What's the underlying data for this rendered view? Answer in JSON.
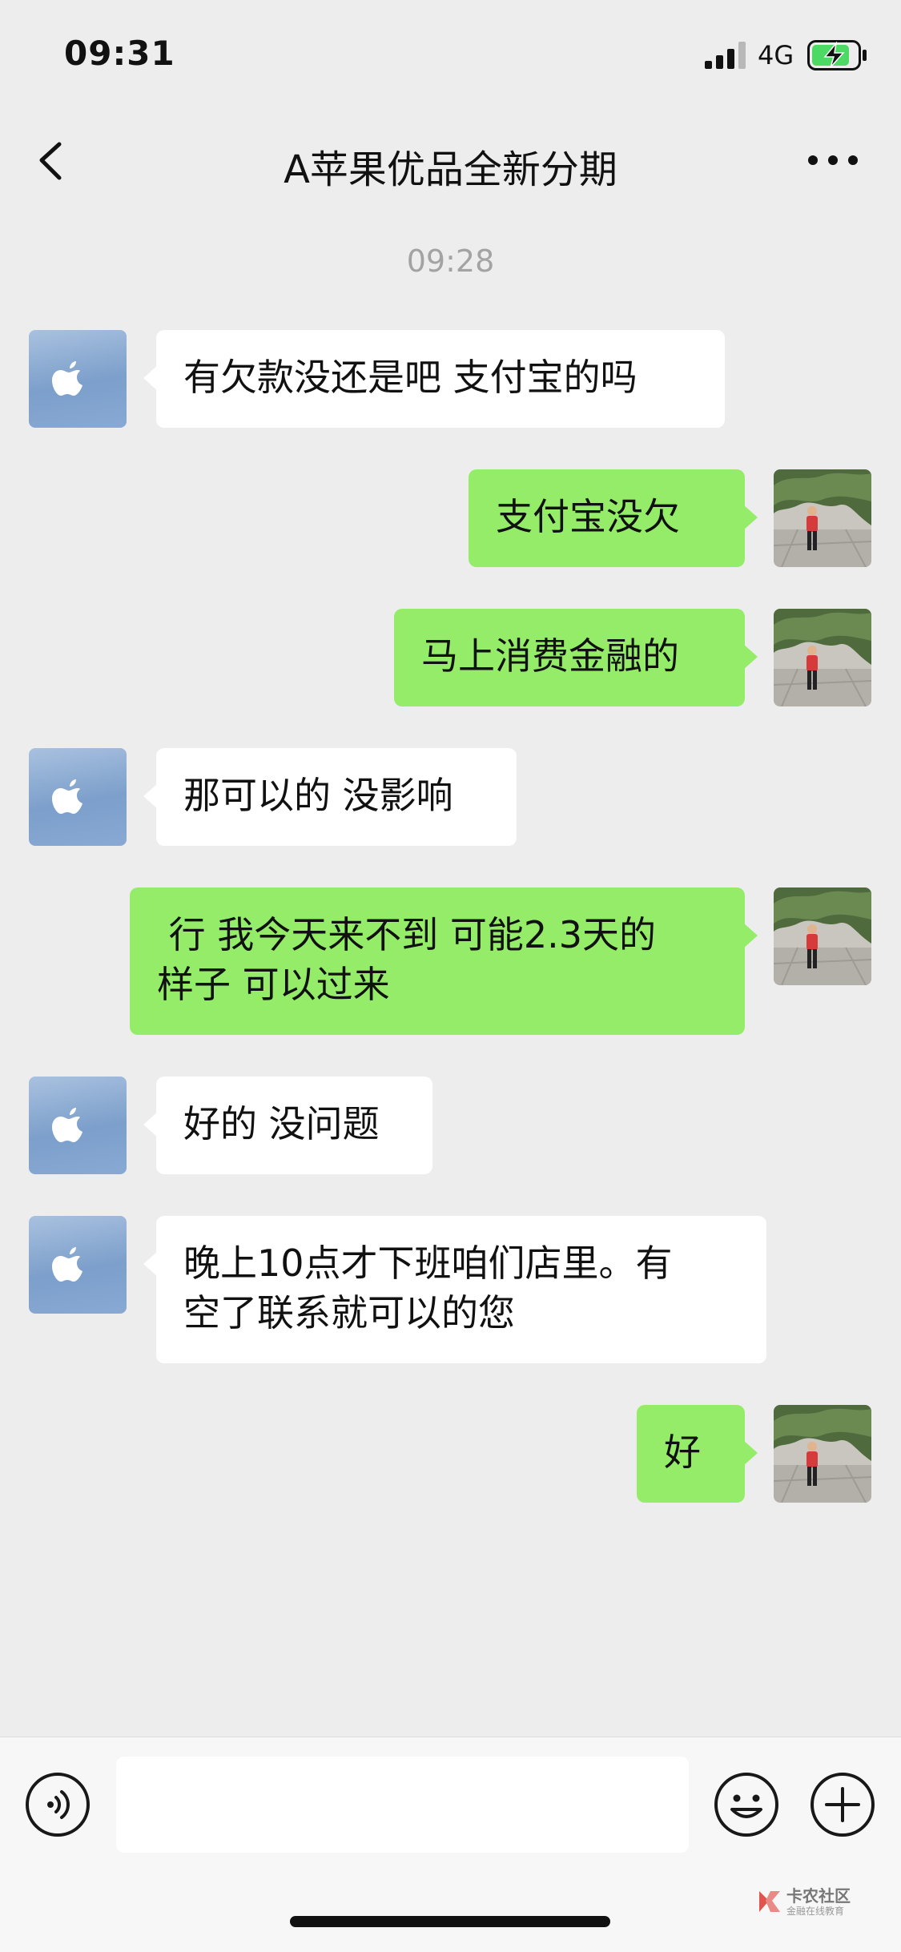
{
  "status_bar": {
    "time": "09:31",
    "network": "4G"
  },
  "header": {
    "title": "A苹果优品全新分期"
  },
  "chat": {
    "timestamp": "09:28",
    "messages": [
      {
        "side": "left",
        "text": "有欠款没还是吧 支付宝的吗"
      },
      {
        "side": "right",
        "text": "支付宝没欠"
      },
      {
        "side": "right",
        "text": "马上消费金融的"
      },
      {
        "side": "left",
        "text": "那可以的 没影响"
      },
      {
        "side": "right",
        "text": " 行 我今天来不到 可能2.3天的\n样子 可以过来"
      },
      {
        "side": "left",
        "text": "好的 没问题"
      },
      {
        "side": "left",
        "text": "晚上10点才下班咱们店里。有\n空了联系就可以的您"
      },
      {
        "side": "right",
        "text": "好"
      }
    ]
  },
  "input_bar": {
    "placeholder": ""
  },
  "watermark": {
    "line1": "卡农社区",
    "line2": "金融在线教育"
  },
  "colors": {
    "background": "#ededed",
    "self_bubble": "#95ec69",
    "other_bubble": "#ffffff"
  }
}
